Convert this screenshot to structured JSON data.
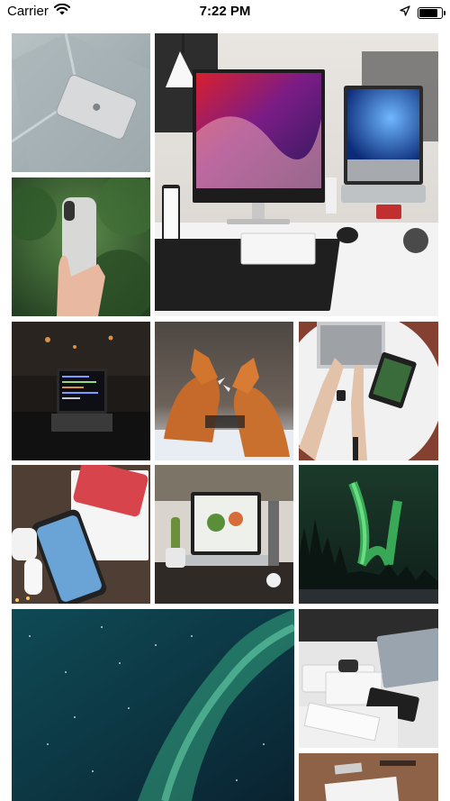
{
  "status_bar": {
    "carrier": "Carrier",
    "time": "7:22 PM",
    "battery_level": 0.85,
    "icons": [
      "wifi-icon",
      "location-arrow-icon",
      "battery-icon"
    ]
  },
  "gallery": {
    "photos": [
      {
        "subject": "laptop-on-sofa"
      },
      {
        "subject": "desk-setup-monitor-laptop"
      },
      {
        "subject": "hand-holding-iphone"
      },
      {
        "subject": "laptop-dark-code"
      },
      {
        "subject": "two-foxes"
      },
      {
        "subject": "hands-typing-laptop-watch"
      },
      {
        "subject": "iphone-airpods-box"
      },
      {
        "subject": "laptop-on-desk-plant"
      },
      {
        "subject": "aurora-over-forest"
      },
      {
        "subject": "aurora-sky"
      },
      {
        "subject": "apple-products-white-desk"
      },
      {
        "subject": "desk-with-paper"
      }
    ]
  }
}
